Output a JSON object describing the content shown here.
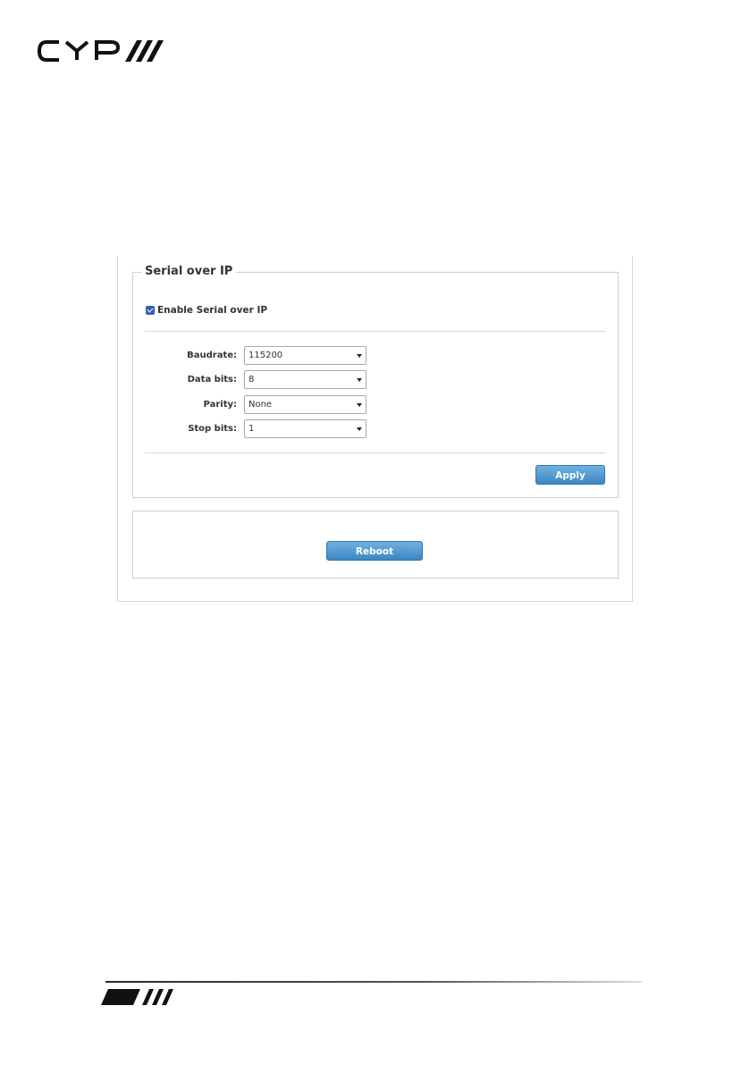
{
  "section": {
    "title": "Serial over IP",
    "enable_label": "Enable Serial over IP",
    "enabled": true
  },
  "fields": {
    "baudrate": {
      "label": "Baudrate:",
      "value": "115200"
    },
    "data_bits": {
      "label": "Data bits:",
      "value": "8"
    },
    "parity": {
      "label": "Parity:",
      "value": "None"
    },
    "stop_bits": {
      "label": "Stop bits:",
      "value": "1"
    }
  },
  "buttons": {
    "apply": "Apply",
    "reboot": "Reboot"
  },
  "colors": {
    "accent": "#3b86c3",
    "checkbox": "#2f62b6"
  }
}
